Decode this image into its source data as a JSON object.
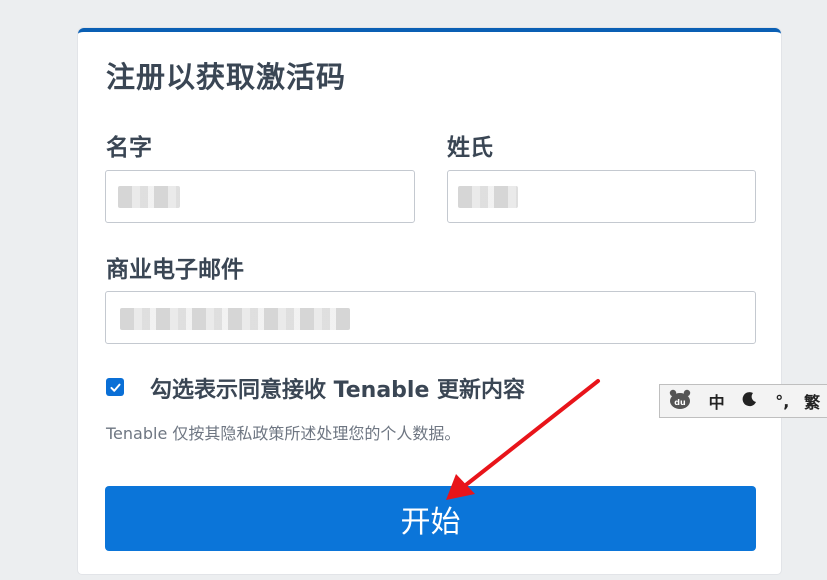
{
  "form": {
    "title": "注册以获取激活码",
    "first_name_label": "名字",
    "last_name_label": "姓氏",
    "email_label": "商业电子邮件",
    "first_name_value": "",
    "last_name_value": "",
    "email_value": "",
    "consent_checked": true,
    "consent_label": "勾选表示同意接收 Tenable 更新内容",
    "privacy_note": "Tenable 仅按其隐私政策所述处理您的个人数据。",
    "submit_label": "开始",
    "accent_color": "#0b75d9"
  },
  "ime_toolbar": {
    "logo_icon": "baidu-paw-icon",
    "lang_label": "中",
    "moon_icon": "moon-icon",
    "punct_label": "°,",
    "trad_label": "繁"
  },
  "annotation": {
    "arrow_color": "#e8141a"
  }
}
